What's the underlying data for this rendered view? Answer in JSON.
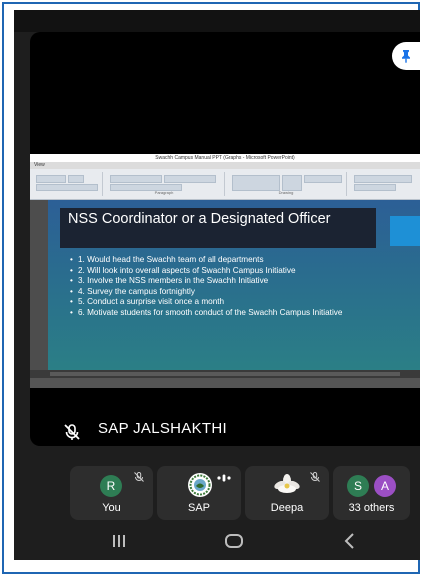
{
  "ppt": {
    "window_title": "Swachh Campus Manual PPT (Graphs - Microsoft PowerPoint)",
    "menu_view": "View",
    "ribbon_group_1": "Paragraph",
    "ribbon_group_2": "Drawing"
  },
  "slide": {
    "title": "NSS Coordinator or a Designated Officer",
    "bullets": [
      "1. Would head the Swachh team of all departments",
      "2. Will look into overall aspects of Swachh Campus Initiative",
      "3. Involve the NSS members in the Swachh Initiative",
      "4. Survey the campus fortnightly",
      "5. Conduct a surprise visit once a month",
      "6. Motivate students for smooth conduct of the Swachh Campus Initiative"
    ]
  },
  "presenter": {
    "name": "SAP JALSHAKTHI",
    "mic_icon": "mic-off-icon"
  },
  "participants": [
    {
      "initial": "R",
      "label": "You",
      "avatar_color": "#2e7d54",
      "muted": true
    },
    {
      "label": "SAP",
      "speaking": true
    },
    {
      "label": "Deepa",
      "muted": true
    },
    {
      "initial_1": "S",
      "initial_2": "A",
      "label": "33 others",
      "avatar_color_1": "#2e7d54",
      "avatar_color_2": "#9b4fc4"
    }
  ],
  "colors": {
    "frame_border": "#1f66b3",
    "app_background": "#1e1e1e",
    "slide_title_bg": "#1b2332",
    "slide_accent": "#1e90d6"
  },
  "nav": {
    "recents_icon": "recents-icon",
    "home_icon": "home-icon",
    "back_icon": "back-icon"
  }
}
